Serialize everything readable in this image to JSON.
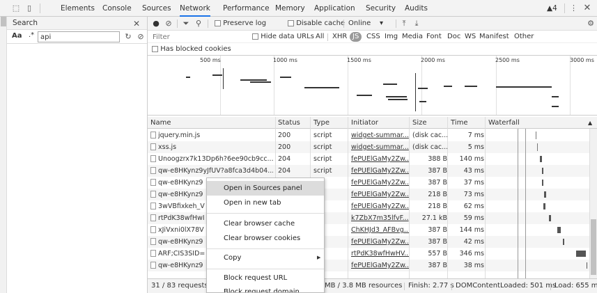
{
  "devtools": {
    "tabs": [
      "Elements",
      "Console",
      "Sources",
      "Network",
      "Performance",
      "Memory",
      "Application",
      "Security",
      "Audits"
    ],
    "active_tab": "Network",
    "warnings": "▲4"
  },
  "search": {
    "title": "Search",
    "case_label": "Aa",
    "regex_label": ".*",
    "query": "api"
  },
  "toolbar": {
    "preserve_log": "Preserve log",
    "disable_cache": "Disable cache",
    "throttle": "Online"
  },
  "filter": {
    "placeholder": "Filter",
    "hide_data_urls": "Hide data URLs",
    "types": [
      "All",
      "XHR",
      "JS",
      "CSS",
      "Img",
      "Media",
      "Font",
      "Doc",
      "WS",
      "Manifest",
      "Other"
    ],
    "active_type": "JS",
    "has_blocked_cookies": "Has blocked cookies"
  },
  "overview": {
    "ticks": [
      "500 ms",
      "1000 ms",
      "1500 ms",
      "2000 ms",
      "2500 ms",
      "3000 ms"
    ]
  },
  "table": {
    "headers": [
      "Name",
      "Status",
      "Type",
      "Initiator",
      "Size",
      "Time",
      "Waterfall"
    ],
    "rows": [
      {
        "name": "jquery.min.js",
        "status": "200",
        "type": "script",
        "initiator": "widget-summar...",
        "size": "(disk cac...",
        "time": "7 ms"
      },
      {
        "name": "xss.js",
        "status": "200",
        "type": "script",
        "initiator": "widget-summar...",
        "size": "(disk cac...",
        "time": "5 ms"
      },
      {
        "name": "Unoogzrx7k13Dp6h?6ee90cb9cc...",
        "status": "204",
        "type": "script",
        "initiator": "fePUElGaMy2Zw...",
        "size": "388 B",
        "time": "140 ms"
      },
      {
        "name": "qw-e8HKynz9yJfUV?a8fca3d4b04...",
        "status": "204",
        "type": "script",
        "initiator": "fePUElGaMy2Zw...",
        "size": "387 B",
        "time": "43 ms"
      },
      {
        "name": "qw-e8HKynz9",
        "status": "",
        "type": "t",
        "initiator": "fePUElGaMy2Zw...",
        "size": "387 B",
        "time": "37 ms"
      },
      {
        "name": "qw-e8HKynz9",
        "status": "",
        "type": "t",
        "initiator": "fePUElGaMy2Zw...",
        "size": "218 B",
        "time": "73 ms"
      },
      {
        "name": "3wVBfixkeh_V",
        "status": "",
        "type": "t",
        "initiator": "fePUElGaMy2Zw...",
        "size": "218 B",
        "time": "62 ms"
      },
      {
        "name": "rtPdK38wfHwI",
        "status": "",
        "type": "t",
        "initiator": "k7ZbX7m35lfvF...",
        "size": "27.1 kB",
        "time": "59 ms"
      },
      {
        "name": "xJiVxni0lX78V",
        "status": "",
        "type": "t",
        "initiator": "ChKHJd3_AFBvg...",
        "size": "387 B",
        "time": "144 ms"
      },
      {
        "name": "qw-e8HKynz9",
        "status": "",
        "type": "t",
        "initiator": "fePUElGaMy2Zw...",
        "size": "387 B",
        "time": "42 ms"
      },
      {
        "name": "ARF;CIS3SID=",
        "status": "",
        "type": "t",
        "initiator": "rtPdK38wfHwHV...",
        "size": "557 B",
        "time": "346 ms"
      },
      {
        "name": "qw-e8HKynz9",
        "status": "",
        "type": "t",
        "initiator": "fePUElGaMy2Zw...",
        "size": "387 B",
        "time": "38 ms"
      }
    ]
  },
  "status": {
    "requests": "31 / 83 requests",
    "resources": "MB / 3.8 MB resources",
    "finish": "Finish: 2.77 s",
    "dcl": "DOMContentLoaded: 501 ms",
    "load": "Load: 655 ms"
  },
  "context_menu": {
    "items": [
      "Open in Sources panel",
      "Open in new tab",
      "Clear browser cache",
      "Clear browser cookies",
      "Copy",
      "Block request URL",
      "Block request domain"
    ]
  }
}
